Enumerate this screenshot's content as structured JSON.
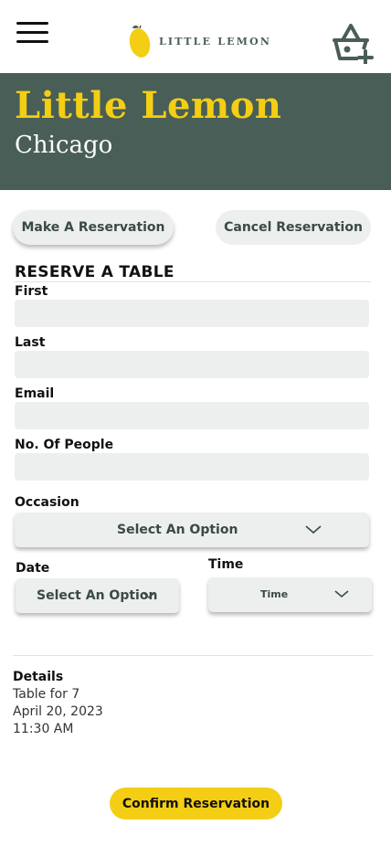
{
  "header": {
    "menu_icon": "hamburger-icon",
    "logo_icon": "lemon-icon",
    "logo_text": "LITTLE LEMON",
    "cart_icon": "basket-add-icon"
  },
  "hero": {
    "title": "Little Lemon",
    "subtitle": "Chicago"
  },
  "actions": {
    "make_label": "Make A Reservation",
    "cancel_label": "Cancel Reservation"
  },
  "form": {
    "title": "RESERVE A TABLE",
    "first_label": "First",
    "first_value": "",
    "last_label": "Last",
    "last_value": "",
    "email_label": "Email",
    "email_value": "",
    "people_label": "No. Of People",
    "people_value": "",
    "occasion_label": "Occasion",
    "occasion_value": "Select An Option",
    "date_label": "Date",
    "date_value": "Select An Option",
    "time_label": "Time",
    "time_value": "Time"
  },
  "details": {
    "title": "Details",
    "table": "Table for 7",
    "date": "April 20, 2023",
    "time": "11:30 AM"
  },
  "confirm_label": "Confirm Reservation",
  "colors": {
    "brand_green": "#495e57",
    "brand_yellow": "#f4ce14",
    "field_bg": "#edefee"
  }
}
